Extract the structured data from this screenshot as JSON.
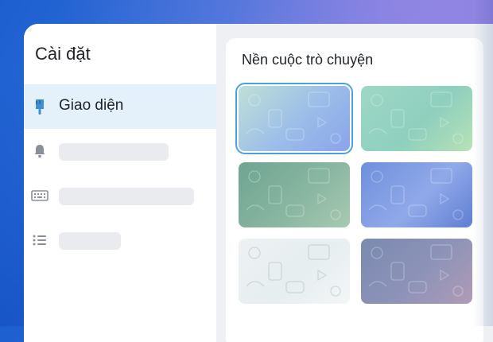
{
  "settings": {
    "title": "Cài đặt",
    "menu": [
      {
        "icon": "paint-brush-icon",
        "label": "Giao diện",
        "active": true
      },
      {
        "icon": "bell-icon",
        "label": "",
        "active": false
      },
      {
        "icon": "keyboard-icon",
        "label": "",
        "active": false
      },
      {
        "icon": "list-icon",
        "label": "",
        "active": false
      }
    ]
  },
  "main": {
    "section_title": "Nền cuộc trò chuyện",
    "backgrounds": [
      {
        "name": "light-blue-gradient",
        "colors": [
          "#bfe0d6",
          "#9bbde9",
          "#8aa4ea"
        ],
        "selected": true
      },
      {
        "name": "mint-teal-gradient",
        "colors": [
          "#9fd7c6",
          "#8fcfbe",
          "#b6e2b7"
        ],
        "selected": false
      },
      {
        "name": "sage-green-gradient",
        "colors": [
          "#6fa592",
          "#88b6a1",
          "#a9c9b2"
        ],
        "selected": false
      },
      {
        "name": "indigo-blue-gradient",
        "colors": [
          "#6f8fdc",
          "#90a9e9",
          "#5f7ed3"
        ],
        "selected": false
      },
      {
        "name": "pale-gray-gradient",
        "colors": [
          "#eef1f2",
          "#e6eef0",
          "#f4f6f7"
        ],
        "selected": false
      },
      {
        "name": "slate-mauve-gradient",
        "colors": [
          "#7a8ab0",
          "#8e93b8",
          "#b09bb6"
        ],
        "selected": false
      }
    ]
  },
  "colors": {
    "accent": "#4aa3e0",
    "active_item_bg": "#e4f1fb",
    "skeleton": "#e9ebee"
  }
}
